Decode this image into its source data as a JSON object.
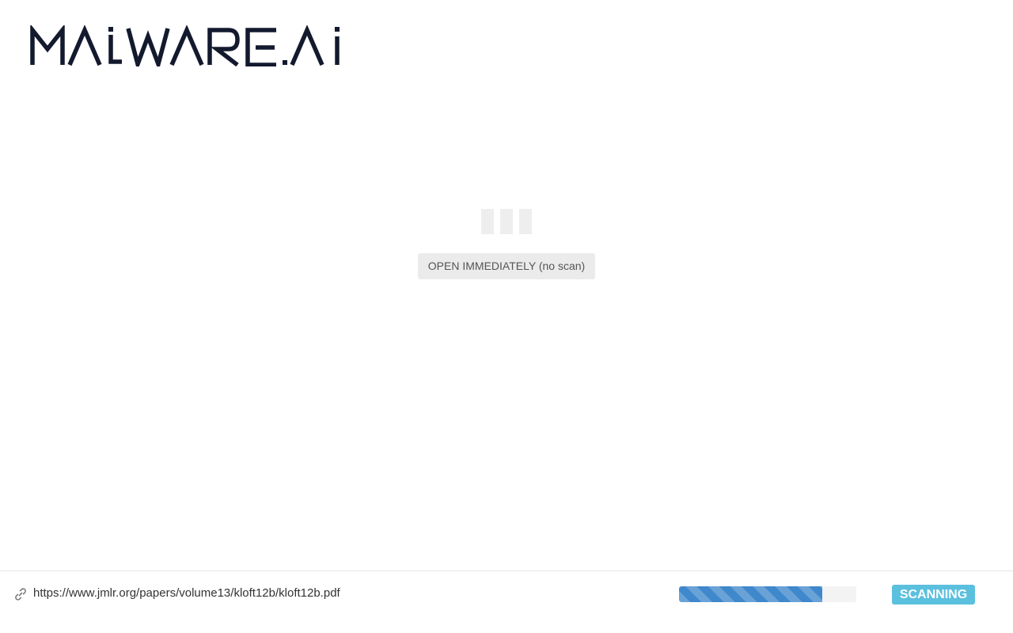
{
  "logo": {
    "text": "MALWARE.Ai",
    "color": "#141a2e"
  },
  "loader": {
    "icon": "loading-bars-icon"
  },
  "actions": {
    "open_label": "OPEN IMMEDIATELY (no scan)"
  },
  "footer": {
    "link_icon": "link-icon",
    "url": "https://www.jmlr.org/papers/volume13/kloft12b/kloft12b.pdf",
    "progress": 0.81,
    "progress_color": "#3f88cc",
    "status": "SCANNING",
    "status_color": "#5bc0de"
  }
}
